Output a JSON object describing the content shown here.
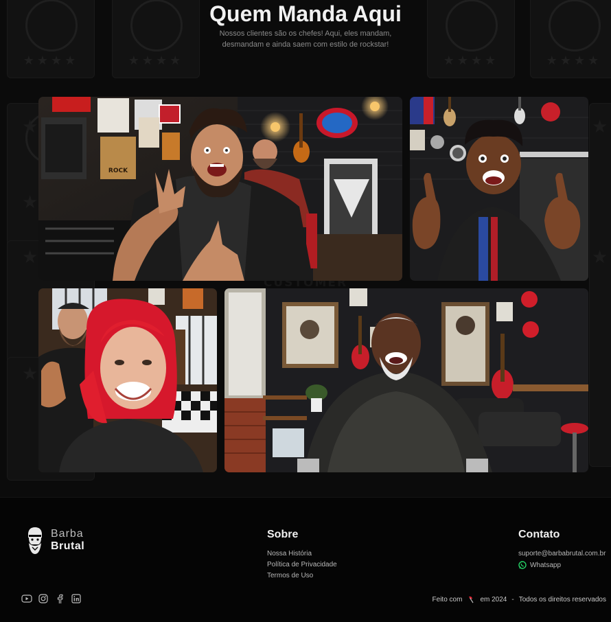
{
  "section": {
    "title": "Quem Manda Aqui",
    "subtitle": "Nossos clientes são os chefes! Aqui, eles mandam, desmandam e ainda saem com estilo de rockstar!",
    "background_watermark": "CUSTOMER REVIEWS"
  },
  "photos": [
    {
      "name": "bearded-client-rock-gesture",
      "shop_sign": "ROCK"
    },
    {
      "name": "boy-thumbs-up"
    },
    {
      "name": "red-hair-woman-smiling"
    },
    {
      "name": "senior-man-laughing"
    }
  ],
  "footer": {
    "brand": {
      "line1": "Barba",
      "line2": "Brutal"
    },
    "about": {
      "title": "Sobre",
      "links": [
        "Nossa História",
        "Política de Privacidade",
        "Termos de Uso"
      ]
    },
    "contact": {
      "title": "Contato",
      "email": "suporte@barbabrutal.com.br",
      "whatsapp": "Whatsapp"
    },
    "social_icons": [
      "youtube-icon",
      "instagram-icon",
      "facebook-icon",
      "linkedin-icon"
    ],
    "copyright": {
      "made_with": "Feito com",
      "icon": "axe-icon",
      "year_text": "em 2024",
      "separator": "-",
      "rights": "Todos os direitos reservados"
    }
  },
  "colors": {
    "background": "#050505",
    "text": "#f1f1f1",
    "muted": "#8a8a8a",
    "whatsapp": "#25d366",
    "accent_red": "#e01e2e"
  }
}
